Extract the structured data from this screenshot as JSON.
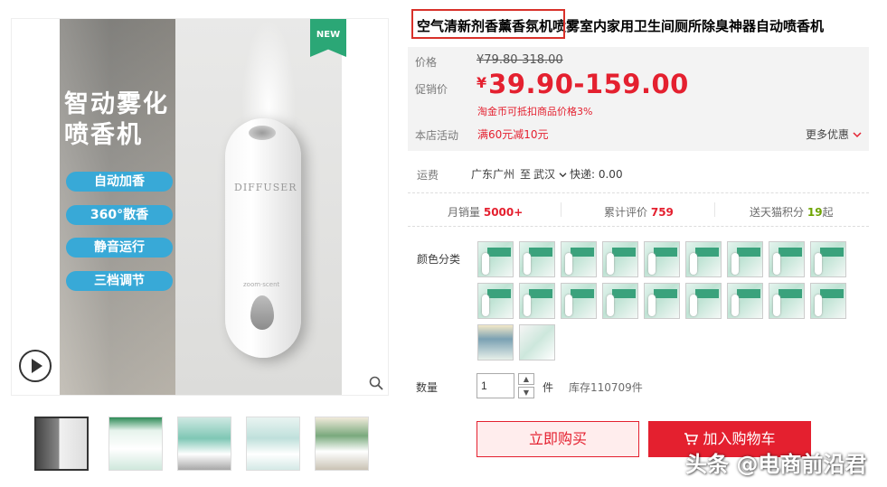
{
  "gallery": {
    "badge": "NEW",
    "headline": [
      "智动雾化",
      "喷香机"
    ],
    "features": [
      "自动加香",
      "360°散香",
      "静音运行",
      "三档调节"
    ],
    "device_brand": "DIFFUSER",
    "device_small_text": "zoom·scent"
  },
  "product": {
    "title": "空气清新剂香薰香氛机喷雾室内家用卫生间厕所除臭神器自动喷香机"
  },
  "price": {
    "label": "价格",
    "original": "¥79.80-318.00",
    "promo_label": "促销价",
    "currency": "¥",
    "promo": "39.90-159.00",
    "coin_note": "淘金币可抵扣商品价格3%",
    "activity_label": "本店活动",
    "activity": "满60元减10元",
    "more_offers": "更多优惠"
  },
  "shipping": {
    "label": "运费",
    "from": "广东广州",
    "to_word": "至",
    "to": "武汉",
    "express": "快递: 0.00"
  },
  "stats": {
    "monthly_label": "月销量",
    "monthly_value": "5000+",
    "reviews_label": "累计评价",
    "reviews_value": "759",
    "points_prefix": "送天猫积分",
    "points_value": "19",
    "points_suffix": "起"
  },
  "options": {
    "color_label": "颜色分类"
  },
  "quantity": {
    "label": "数量",
    "value": "1",
    "unit": "件",
    "stock": "库存110709件"
  },
  "actions": {
    "buy_now": "立即购买",
    "add_to_cart": "加入购物车"
  },
  "watermark": "头条 @电商前沿君",
  "colors": {
    "accent_red": "#e4202f",
    "title_box": "#d8312a",
    "feature_pill": "#38a9d7",
    "new_badge": "#2ba776"
  }
}
